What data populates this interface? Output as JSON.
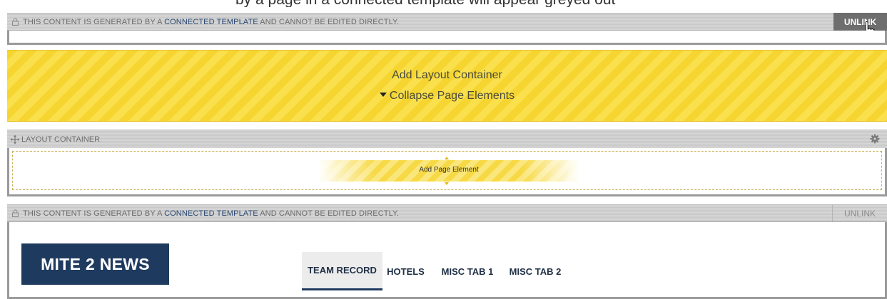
{
  "top_partial_text": "by a page in a connected template will appear greyed out",
  "connected_template_bar_1": {
    "message_prefix": "THIS CONTENT IS GENERATED BY A",
    "link": "CONNECTED TEMPLATE",
    "message_suffix": "AND CANNOT BE EDITED DIRECTLY.",
    "unlink": "UNLINK"
  },
  "add_layout_container": "Add Layout Container",
  "collapse_page_elements": "Collapse Page Elements",
  "layout_container": {
    "title": "LAYOUT CONTAINER",
    "add_page_element": "Add Page Element"
  },
  "connected_template_bar_2": {
    "message_prefix": "THIS CONTENT IS GENERATED BY A",
    "link": "CONNECTED TEMPLATE",
    "message_suffix": "AND CANNOT BE EDITED DIRECTLY.",
    "unlink": "UNLINK"
  },
  "news": {
    "title": "MITE 2 NEWS",
    "tabs": [
      "TEAM RECORD",
      "HOTELS",
      "MISC TAB 1",
      "MISC TAB 2"
    ],
    "active_tab": "TEAM RECORD"
  },
  "colors": {
    "accent_navy": "#1f3a5f",
    "highlight_yellow": "#f6d531",
    "bar_grey": "#cfcfcf",
    "unlink_active": "#6e6e6e"
  }
}
